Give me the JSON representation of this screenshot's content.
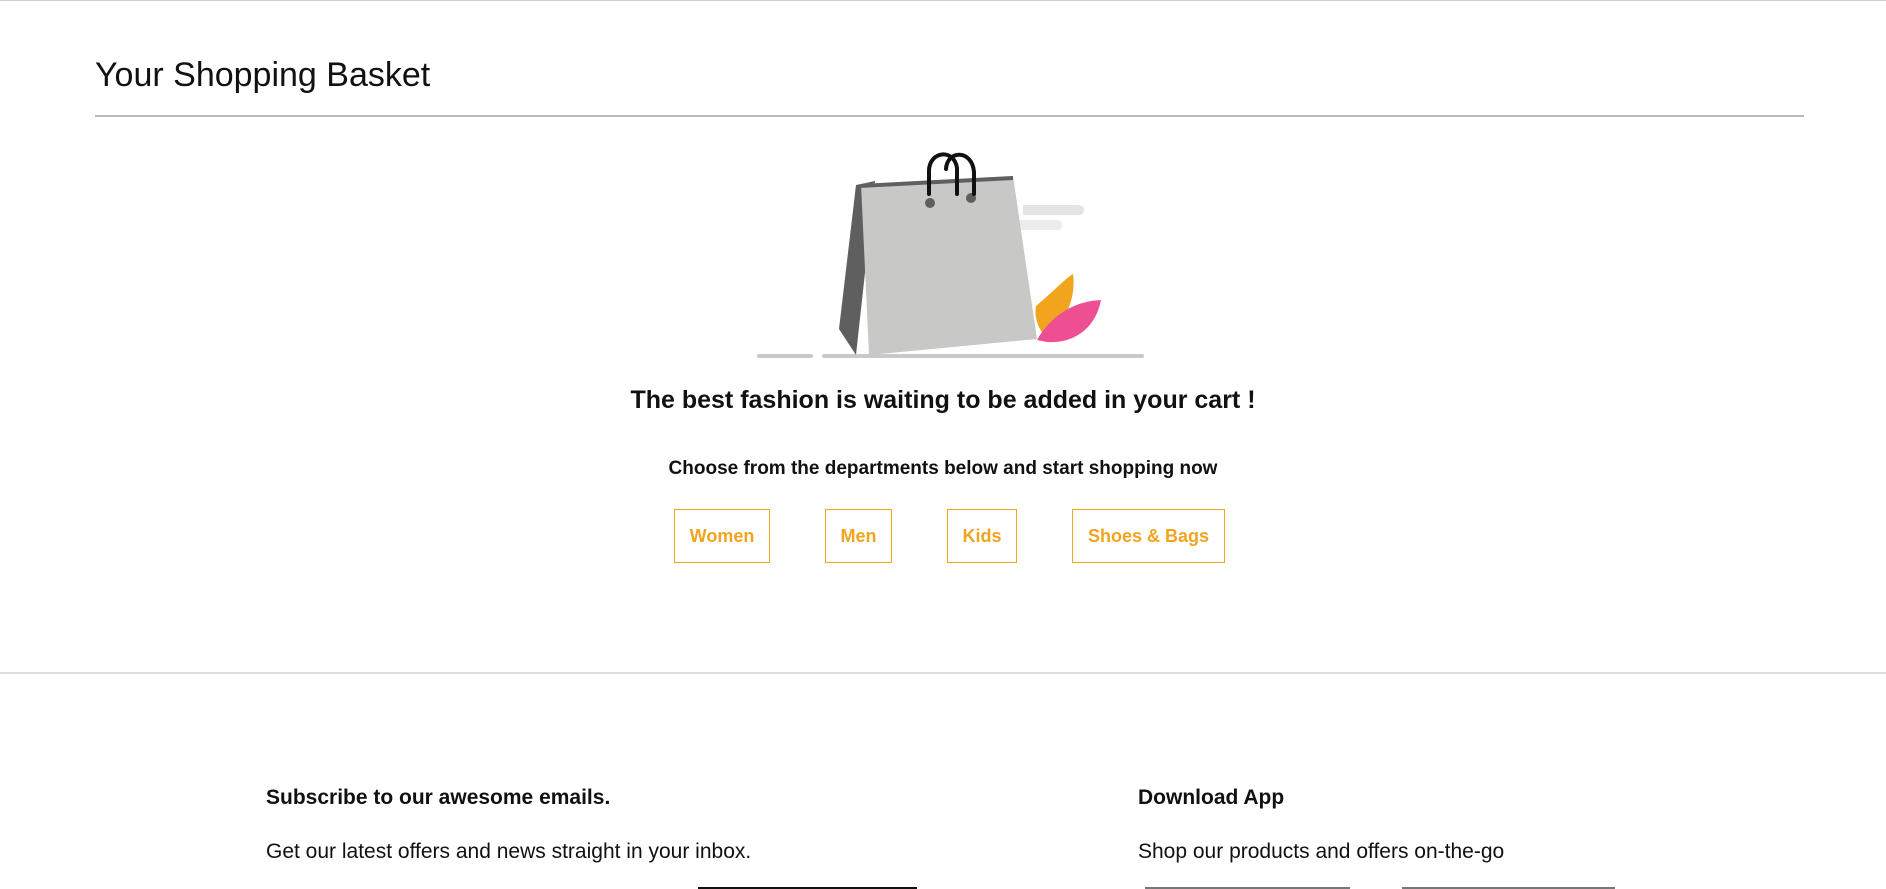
{
  "page": {
    "title": "Your Shopping Basket"
  },
  "empty_cart": {
    "illustration_icon": "empty-shopping-bag-icon",
    "message": "The best fashion is waiting to be added in your cart !",
    "prompt": "Choose from the departments below and start shopping now"
  },
  "departments": [
    {
      "label": "Women"
    },
    {
      "label": "Men"
    },
    {
      "label": "Kids"
    },
    {
      "label": "Shoes & Bags"
    }
  ],
  "footer": {
    "subscribe": {
      "heading": "Subscribe to our awesome emails.",
      "text": "Get our latest offers and news straight in your inbox."
    },
    "app": {
      "heading": "Download App",
      "text": "Shop our products and offers on-the-go"
    }
  },
  "colors": {
    "accent": "#f3a41f",
    "pink": "#ee4f93",
    "bag_light": "#c8c8c6",
    "bag_dark": "#5f5f5f",
    "divider": "#d8d8d8"
  }
}
